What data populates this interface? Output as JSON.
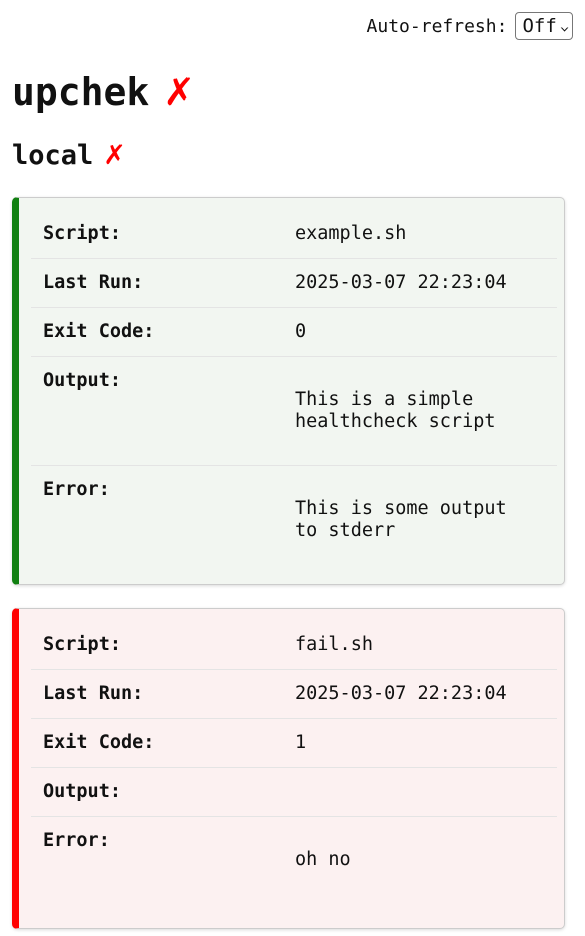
{
  "header": {
    "auto_refresh_label": "Auto-refresh:",
    "auto_refresh_value": "Off"
  },
  "title": "upchek",
  "title_status": "✗",
  "host": {
    "name": "local",
    "status": "✗"
  },
  "labels": {
    "script": "Script:",
    "last_run": "Last Run:",
    "exit_code": "Exit Code:",
    "output": "Output:",
    "error": "Error:"
  },
  "checks": [
    {
      "status": "ok",
      "script": "example.sh",
      "last_run": "2025-03-07 22:23:04",
      "exit_code": "0",
      "output": "This is a simple\nhealthcheck script",
      "error": "This is some output\nto stderr"
    },
    {
      "status": "fail",
      "script": "fail.sh",
      "last_run": "2025-03-07 22:23:04",
      "exit_code": "1",
      "output": "",
      "error": "oh no"
    }
  ]
}
